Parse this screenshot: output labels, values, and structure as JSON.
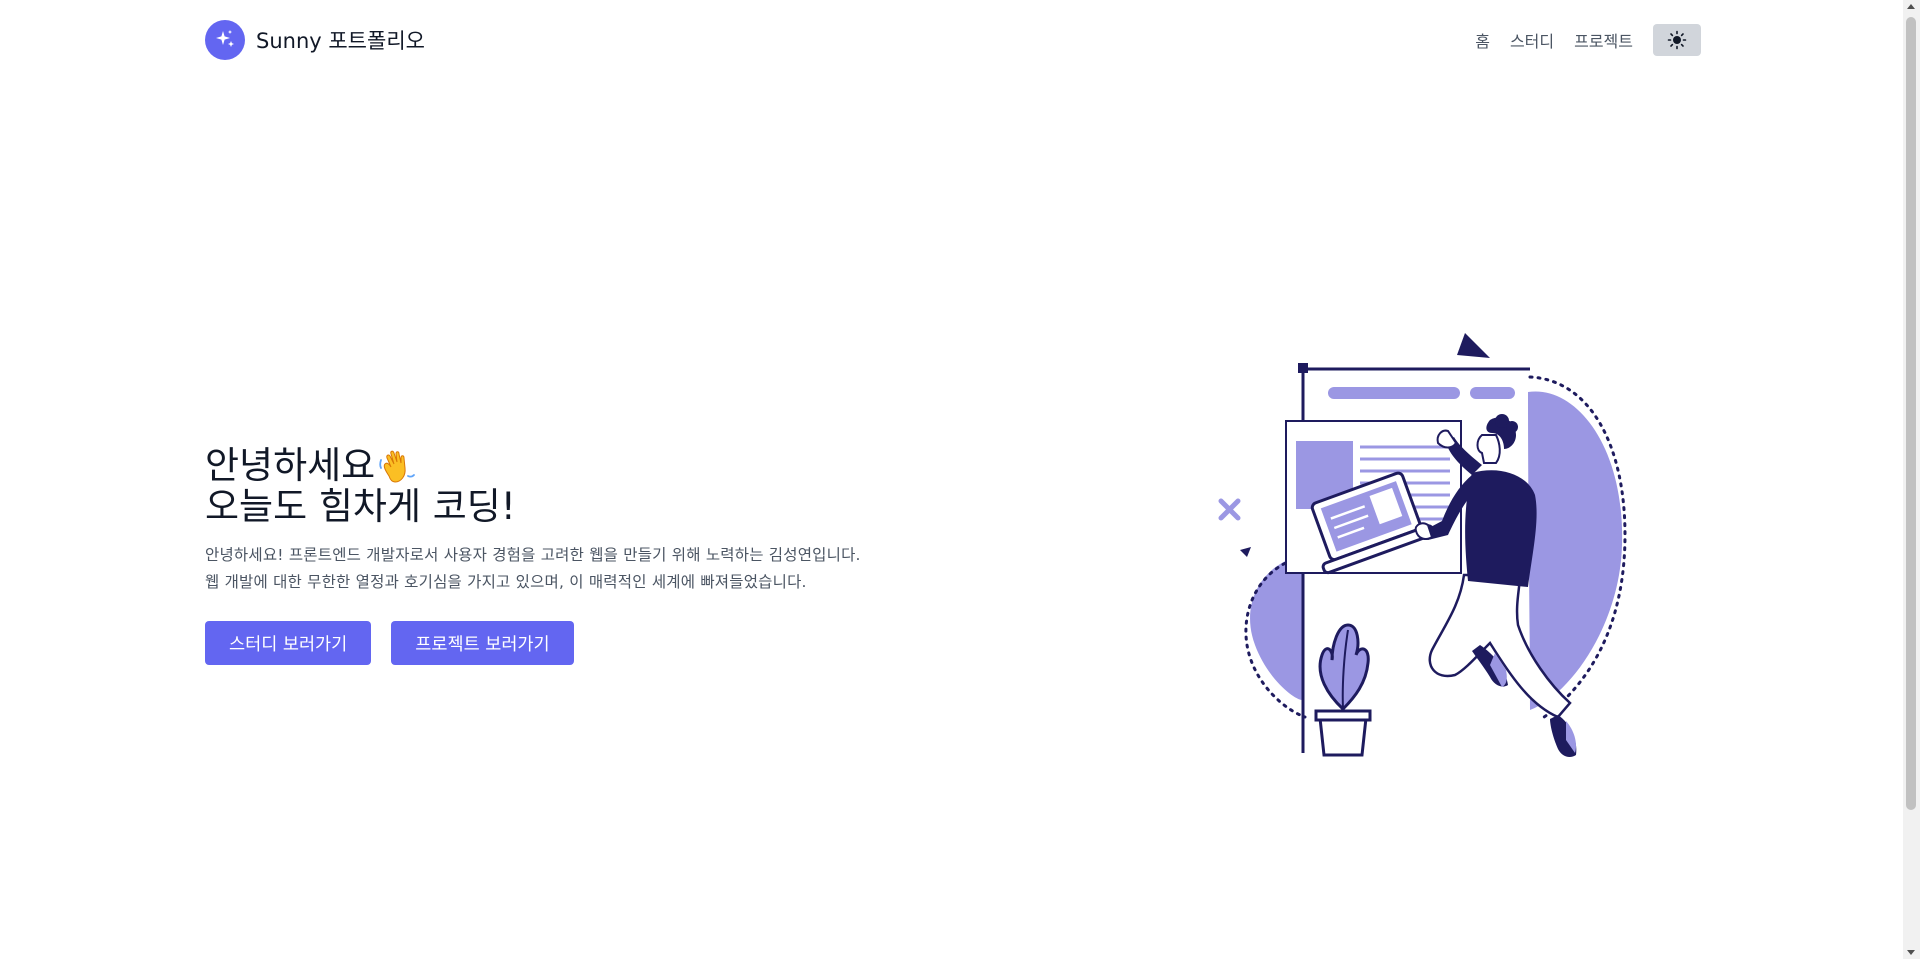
{
  "header": {
    "brand_name": "Sunny 포트폴리오",
    "logo_icon": "sparkles-icon",
    "nav": [
      {
        "label": "홈"
      },
      {
        "label": "스터디"
      },
      {
        "label": "프로젝트"
      }
    ],
    "theme_toggle_icon": "sun-icon"
  },
  "hero": {
    "title_line1": "안녕하세요",
    "title_emoji_icon": "waving-hand-icon",
    "title_line2": "오늘도 힘차게 코딩!",
    "description_line1": "안녕하세요! 프론트엔드 개발자로서 사용자 경험을 고려한 웹을 만들기 위해 노력하는 김성연입니다.",
    "description_line2": "웹 개발에 대한 무한한 열정과 호기심을 가지고 있으며, 이 매력적인 세계에 빠져들었습니다.",
    "buttons": [
      {
        "label": "스터디 보러가기"
      },
      {
        "label": "프로젝트 보러가기"
      }
    ]
  },
  "illustration": {
    "name": "developer-with-laptop-illustration"
  },
  "colors": {
    "accent": "#6366f1",
    "illustration_light": "#9b97e3",
    "illustration_dark": "#1e1b5e"
  }
}
